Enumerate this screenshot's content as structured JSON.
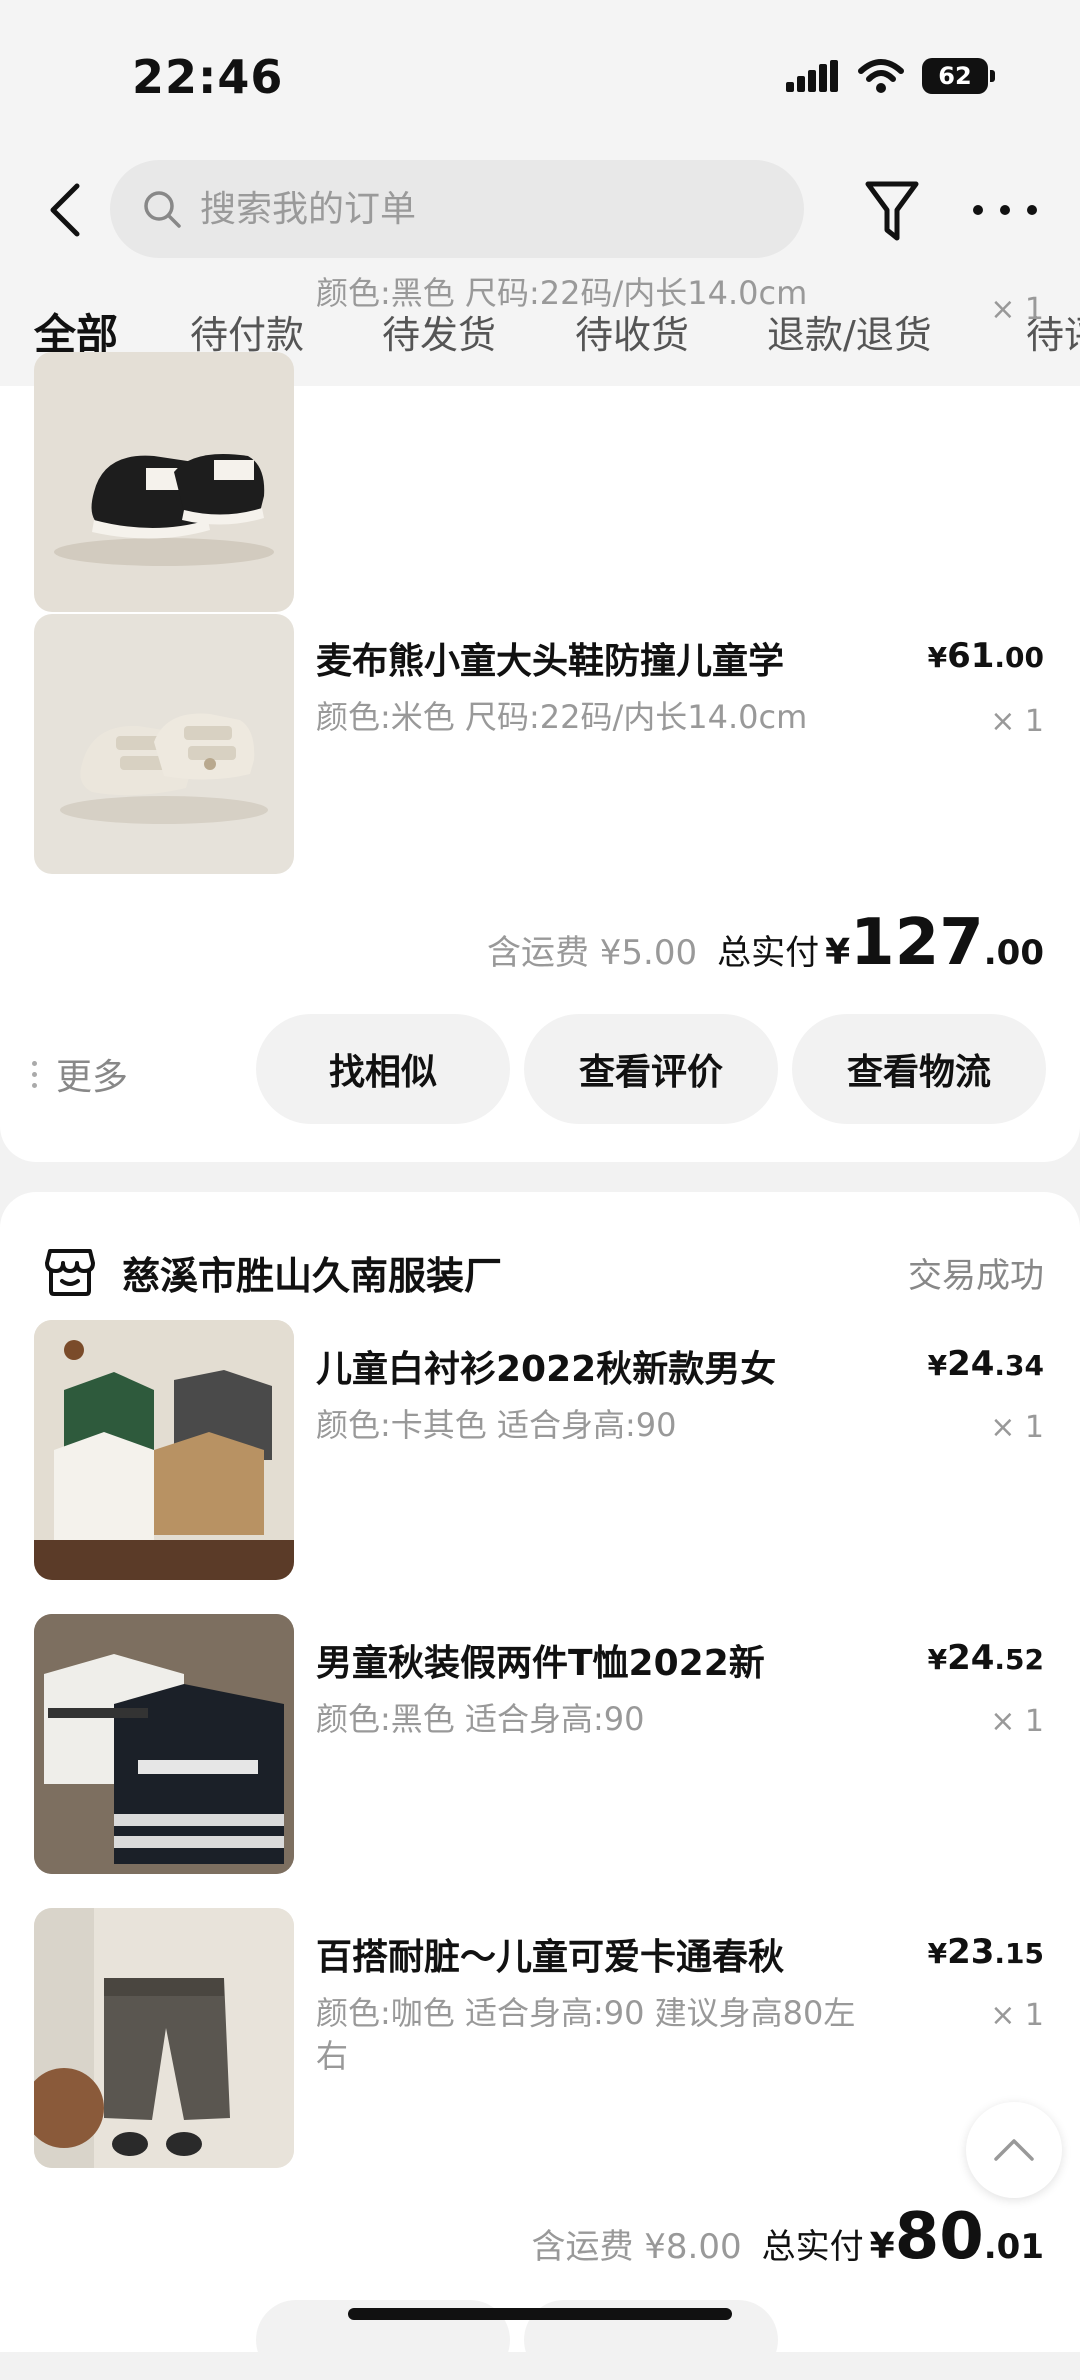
{
  "status_bar": {
    "time": "22:46",
    "battery": "62"
  },
  "search": {
    "placeholder": "搜索我的订单"
  },
  "tabs": [
    "全部",
    "待付款",
    "待发货",
    "待收货",
    "退款/退货",
    "待评价"
  ],
  "order1": {
    "items": [
      {
        "spec": "颜色:黑色 尺码:22码/内长14.0cm",
        "qty": "× 1"
      },
      {
        "title": "麦布熊小童大头鞋防撞儿童学",
        "spec": "颜色:米色 尺码:22码/内长14.0cm",
        "price_int": "61",
        "price_dec": ".00",
        "qty": "× 1"
      }
    ],
    "shipping": "含运费 ¥5.00",
    "total_label": "总实付",
    "total_int": "127",
    "total_dec": ".00",
    "more": "更多",
    "buttons": [
      "找相似",
      "查看评价",
      "查看物流"
    ]
  },
  "order2": {
    "shop_name": "慈溪市胜山久南服装厂",
    "status": "交易成功",
    "items": [
      {
        "title": "儿童白衬衫2022秋新款男女",
        "spec": "颜色:卡其色 适合身高:90",
        "price_int": "24",
        "price_dec": ".34",
        "qty": "× 1"
      },
      {
        "title": "男童秋装假两件T恤2022新",
        "spec": "颜色:黑色 适合身高:90",
        "price_int": "24",
        "price_dec": ".52",
        "qty": "× 1"
      },
      {
        "title": "百搭耐脏～儿童可爱卡通春秋",
        "spec": "颜色:咖色 适合身高:90 建议身高80左右",
        "price_int": "23",
        "price_dec": ".15",
        "qty": "× 1"
      }
    ],
    "shipping": "含运费 ¥8.00",
    "total_label": "总实付",
    "total_int": "80",
    "total_dec": ".01"
  },
  "currency": "¥",
  "icons": [
    "back-arrow-icon",
    "search-icon",
    "filter-icon",
    "more-dots-icon",
    "store-icon",
    "chevron-up-icon",
    "wifi-icon",
    "signal-icon"
  ]
}
